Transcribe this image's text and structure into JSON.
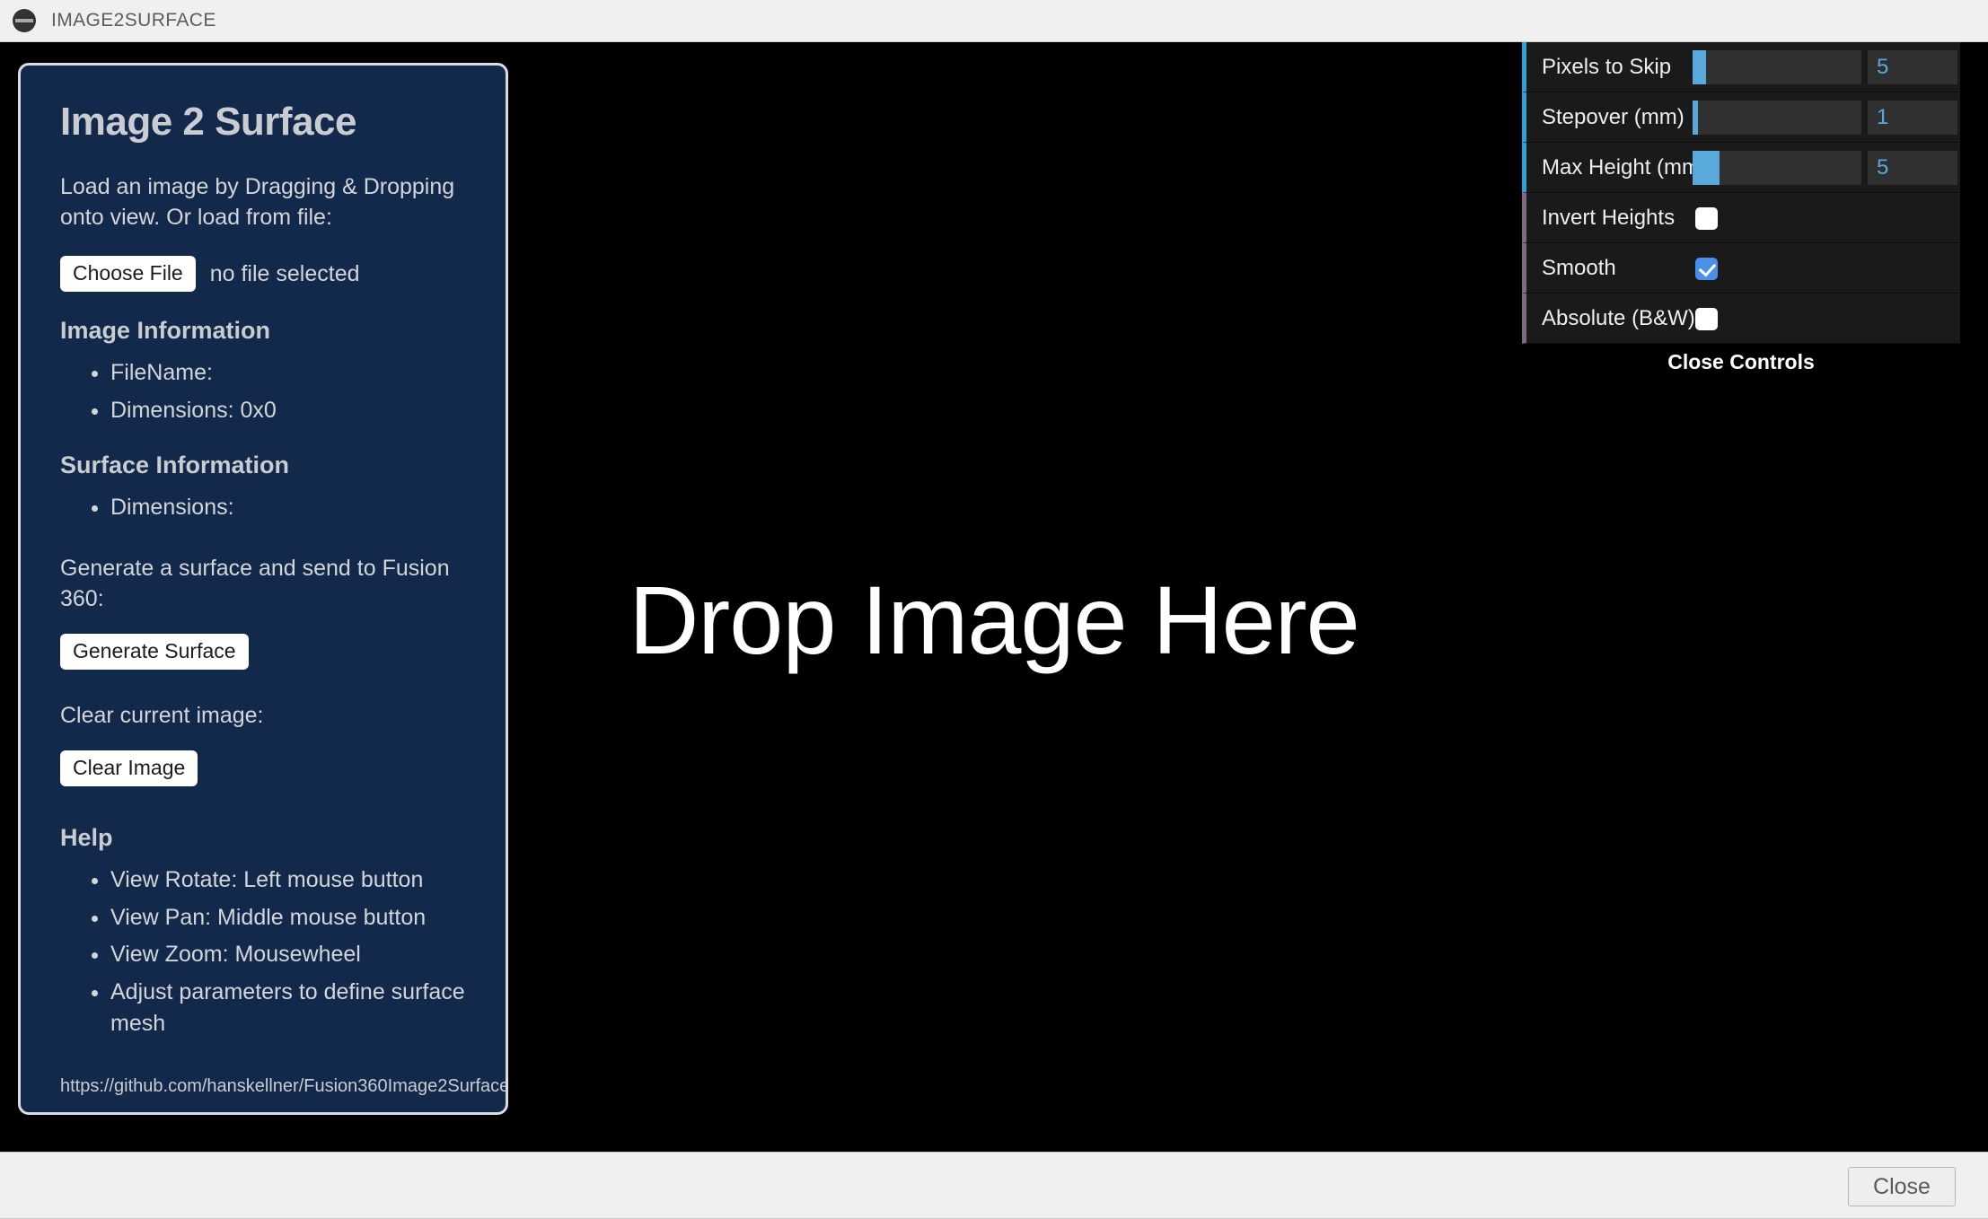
{
  "window": {
    "title": "IMAGE2SURFACE",
    "icon": "minimize-circle-icon"
  },
  "viewport": {
    "drop_prompt": "Drop Image Here",
    "background_color": "#000000"
  },
  "info_panel": {
    "heading": "Image 2 Surface",
    "load_instructions": "Load an image by Dragging & Dropping onto view. Or load from file:",
    "file_input": {
      "button_label": "Choose File",
      "status_text": "no file selected"
    },
    "image_information": {
      "heading": "Image Information",
      "items": [
        "FileName:",
        "Dimensions: 0x0"
      ]
    },
    "surface_information": {
      "heading": "Surface Information",
      "items": [
        "Dimensions:"
      ]
    },
    "generate": {
      "label": "Generate a surface and send to Fusion 360:",
      "button_label": "Generate Surface"
    },
    "clear": {
      "label": "Clear current image:",
      "button_label": "Clear Image"
    },
    "help": {
      "heading": "Help",
      "items": [
        "View Rotate: Left mouse button",
        "View Pan: Middle mouse button",
        "View Zoom: Mousewheel",
        "Adjust parameters to define surface mesh"
      ]
    },
    "url": "https://github.com/hanskellner/Fusion360Image2Surface",
    "background_color": "#13294b",
    "border_color": "#d9dce0"
  },
  "controls": {
    "accent_slider_color": "#2fa1d6",
    "accent_boolean_color": "#806787",
    "sliders": [
      {
        "label": "Pixels to Skip",
        "value": "5",
        "fill_percent": 8
      },
      {
        "label": "Stepover (mm)",
        "value": "1",
        "fill_percent": 3
      },
      {
        "label": "Max Height (mm",
        "value": "5",
        "fill_percent": 16
      }
    ],
    "booleans": [
      {
        "label": "Invert Heights",
        "checked": false
      },
      {
        "label": "Smooth",
        "checked": true
      },
      {
        "label": "Absolute (B&W)",
        "checked": false
      }
    ],
    "close_label": "Close Controls"
  },
  "bottom_bar": {
    "close_label": "Close"
  }
}
